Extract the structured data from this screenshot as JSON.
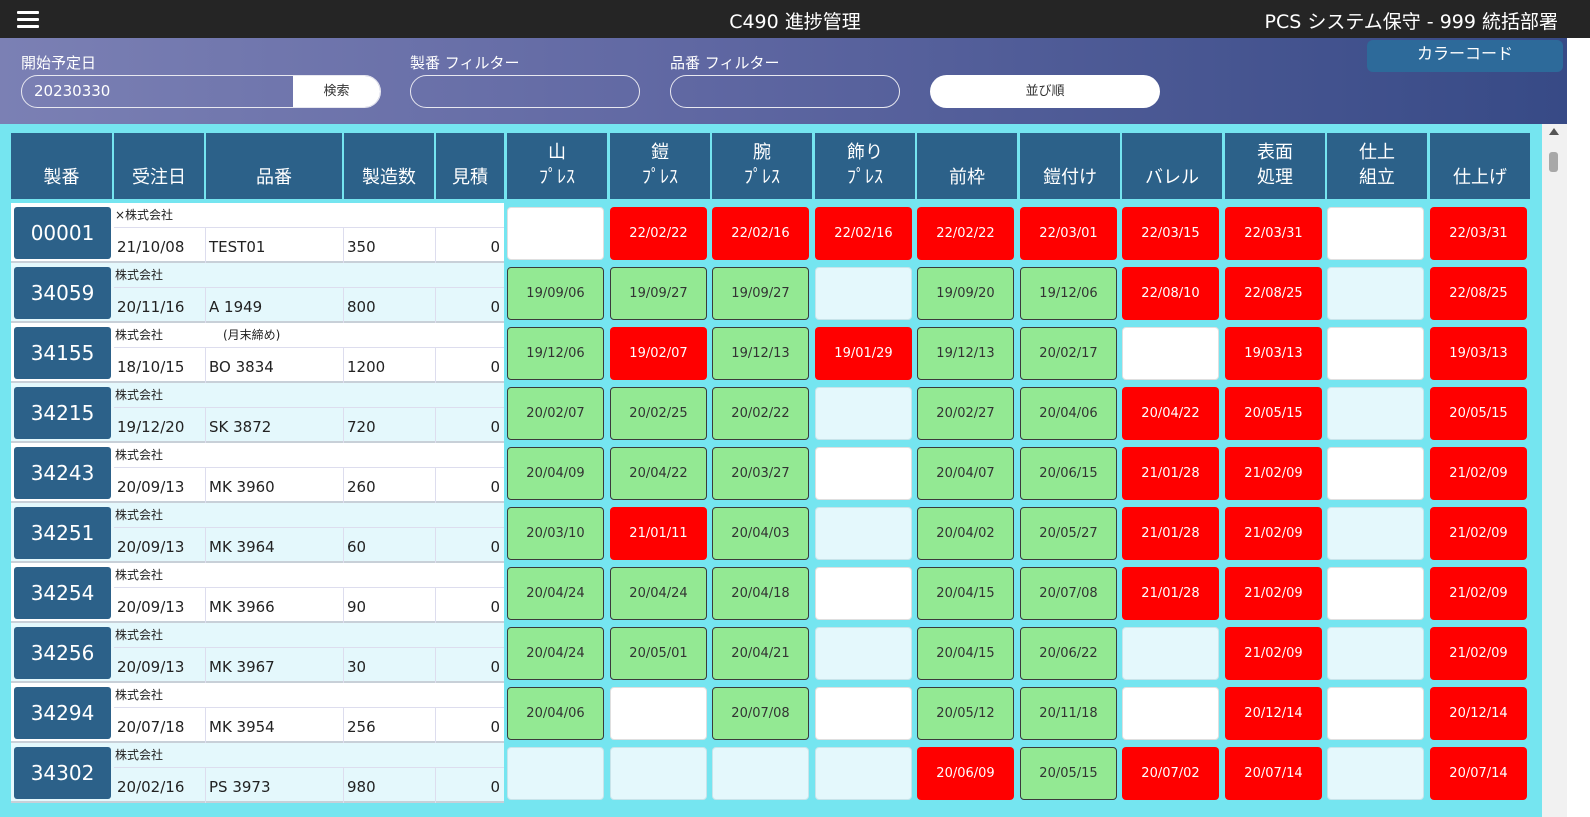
{
  "topbar": {
    "title": "C490 進捗管理",
    "user": "PCS システム保守 - 999 統括部署"
  },
  "filters": {
    "start_date_label": "開始予定日",
    "start_date_value": "20230330",
    "search_label": "検索",
    "seiban_label": "製番 フィルター",
    "seiban_value": "",
    "hinban_label": "品番 フィルター",
    "hinban_value": "",
    "sort_label": "並び順",
    "color_code_label": "カラーコード"
  },
  "colors": {
    "red": "#ff0000",
    "green": "#93e993",
    "header_blue": "#2c6189",
    "background_cyan": "#75e5f0"
  },
  "columns": [
    "製番",
    "受注日",
    "品番",
    "製造数",
    "見積",
    "山\nﾌﾟﾚｽ",
    "鎧\nﾌﾟﾚｽ",
    "腕\nﾌﾟﾚｽ",
    "飾り\nﾌﾟﾚｽ",
    "前枠",
    "鎧付け",
    "バレル",
    "表面\n処理",
    "仕上\n組立",
    "仕上げ"
  ],
  "rows": [
    {
      "id": "00001",
      "customer": "×株式会社",
      "date": "21/10/08",
      "hinban": "TEST01",
      "qty": "350",
      "estimate": "0",
      "cells": [
        [
          "w",
          ""
        ],
        [
          "r",
          "22/02/22"
        ],
        [
          "r",
          "22/02/16"
        ],
        [
          "r",
          "22/02/16"
        ],
        [
          "r",
          "22/02/22"
        ],
        [
          "r",
          "22/03/01"
        ],
        [
          "r",
          "22/03/15"
        ],
        [
          "r",
          "22/03/31"
        ],
        [
          "w",
          ""
        ],
        [
          "r",
          "22/03/31"
        ]
      ]
    },
    {
      "id": "34059",
      "customer": "株式会社",
      "date": "20/11/16",
      "hinban": "A 1949",
      "qty": "800",
      "estimate": "0",
      "cells": [
        [
          "g",
          "19/09/06"
        ],
        [
          "g",
          "19/09/27"
        ],
        [
          "g",
          "19/09/27"
        ],
        [
          "c",
          ""
        ],
        [
          "g",
          "19/09/20"
        ],
        [
          "g",
          "19/12/06"
        ],
        [
          "r",
          "22/08/10"
        ],
        [
          "r",
          "22/08/25"
        ],
        [
          "c",
          ""
        ],
        [
          "r",
          "22/08/25"
        ]
      ]
    },
    {
      "id": "34155",
      "customer": "株式会社　　　　　(月末締め)",
      "date": "18/10/15",
      "hinban": "BO 3834",
      "qty": "1200",
      "estimate": "0",
      "cells": [
        [
          "g",
          "19/12/06"
        ],
        [
          "r",
          "19/02/07"
        ],
        [
          "g",
          "19/12/13"
        ],
        [
          "r",
          "19/01/29"
        ],
        [
          "g",
          "19/12/13"
        ],
        [
          "g",
          "20/02/17"
        ],
        [
          "w",
          ""
        ],
        [
          "r",
          "19/03/13"
        ],
        [
          "w",
          ""
        ],
        [
          "r",
          "19/03/13"
        ]
      ]
    },
    {
      "id": "34215",
      "customer": "株式会社",
      "date": "19/12/20",
      "hinban": "SK 3872",
      "qty": "720",
      "estimate": "0",
      "cells": [
        [
          "g",
          "20/02/07"
        ],
        [
          "g",
          "20/02/25"
        ],
        [
          "g",
          "20/02/22"
        ],
        [
          "c",
          ""
        ],
        [
          "g",
          "20/02/27"
        ],
        [
          "g",
          "20/04/06"
        ],
        [
          "r",
          "20/04/22"
        ],
        [
          "r",
          "20/05/15"
        ],
        [
          "c",
          ""
        ],
        [
          "r",
          "20/05/15"
        ]
      ]
    },
    {
      "id": "34243",
      "customer": "株式会社",
      "date": "20/09/13",
      "hinban": "MK 3960",
      "qty": "260",
      "estimate": "0",
      "cells": [
        [
          "g",
          "20/04/09"
        ],
        [
          "g",
          "20/04/22"
        ],
        [
          "g",
          "20/03/27"
        ],
        [
          "w",
          ""
        ],
        [
          "g",
          "20/04/07"
        ],
        [
          "g",
          "20/06/15"
        ],
        [
          "r",
          "21/01/28"
        ],
        [
          "r",
          "21/02/09"
        ],
        [
          "w",
          ""
        ],
        [
          "r",
          "21/02/09"
        ]
      ]
    },
    {
      "id": "34251",
      "customer": "株式会社",
      "date": "20/09/13",
      "hinban": "MK 3964",
      "qty": "60",
      "estimate": "0",
      "cells": [
        [
          "g",
          "20/03/10"
        ],
        [
          "r",
          "21/01/11"
        ],
        [
          "g",
          "20/04/03"
        ],
        [
          "c",
          ""
        ],
        [
          "g",
          "20/04/02"
        ],
        [
          "g",
          "20/05/27"
        ],
        [
          "r",
          "21/01/28"
        ],
        [
          "r",
          "21/02/09"
        ],
        [
          "c",
          ""
        ],
        [
          "r",
          "21/02/09"
        ]
      ]
    },
    {
      "id": "34254",
      "customer": "株式会社",
      "date": "20/09/13",
      "hinban": "MK 3966",
      "qty": "90",
      "estimate": "0",
      "cells": [
        [
          "g",
          "20/04/24"
        ],
        [
          "g",
          "20/04/24"
        ],
        [
          "g",
          "20/04/18"
        ],
        [
          "w",
          ""
        ],
        [
          "g",
          "20/04/15"
        ],
        [
          "g",
          "20/07/08"
        ],
        [
          "r",
          "21/01/28"
        ],
        [
          "r",
          "21/02/09"
        ],
        [
          "w",
          ""
        ],
        [
          "r",
          "21/02/09"
        ]
      ]
    },
    {
      "id": "34256",
      "customer": "株式会社",
      "date": "20/09/13",
      "hinban": "MK 3967",
      "qty": "30",
      "estimate": "0",
      "cells": [
        [
          "g",
          "20/04/24"
        ],
        [
          "g",
          "20/05/01"
        ],
        [
          "g",
          "20/04/21"
        ],
        [
          "c",
          ""
        ],
        [
          "g",
          "20/04/15"
        ],
        [
          "g",
          "20/06/22"
        ],
        [
          "c",
          ""
        ],
        [
          "r",
          "21/02/09"
        ],
        [
          "c",
          ""
        ],
        [
          "r",
          "21/02/09"
        ]
      ]
    },
    {
      "id": "34294",
      "customer": "株式会社",
      "date": "20/07/18",
      "hinban": "MK 3954",
      "qty": "256",
      "estimate": "0",
      "cells": [
        [
          "g",
          "20/04/06"
        ],
        [
          "w",
          ""
        ],
        [
          "g",
          "20/07/08"
        ],
        [
          "w",
          ""
        ],
        [
          "g",
          "20/05/12"
        ],
        [
          "g",
          "20/11/18"
        ],
        [
          "w",
          ""
        ],
        [
          "r",
          "20/12/14"
        ],
        [
          "w",
          ""
        ],
        [
          "r",
          "20/12/14"
        ]
      ]
    },
    {
      "id": "34302",
      "customer": "株式会社",
      "date": "20/02/16",
      "hinban": "PS 3973",
      "qty": "980",
      "estimate": "0",
      "cells": [
        [
          "c",
          ""
        ],
        [
          "c",
          ""
        ],
        [
          "c",
          ""
        ],
        [
          "c",
          ""
        ],
        [
          "r",
          "20/06/09"
        ],
        [
          "g",
          "20/05/15"
        ],
        [
          "r",
          "20/07/02"
        ],
        [
          "r",
          "20/07/14"
        ],
        [
          "c",
          ""
        ],
        [
          "r",
          "20/07/14"
        ]
      ]
    }
  ]
}
